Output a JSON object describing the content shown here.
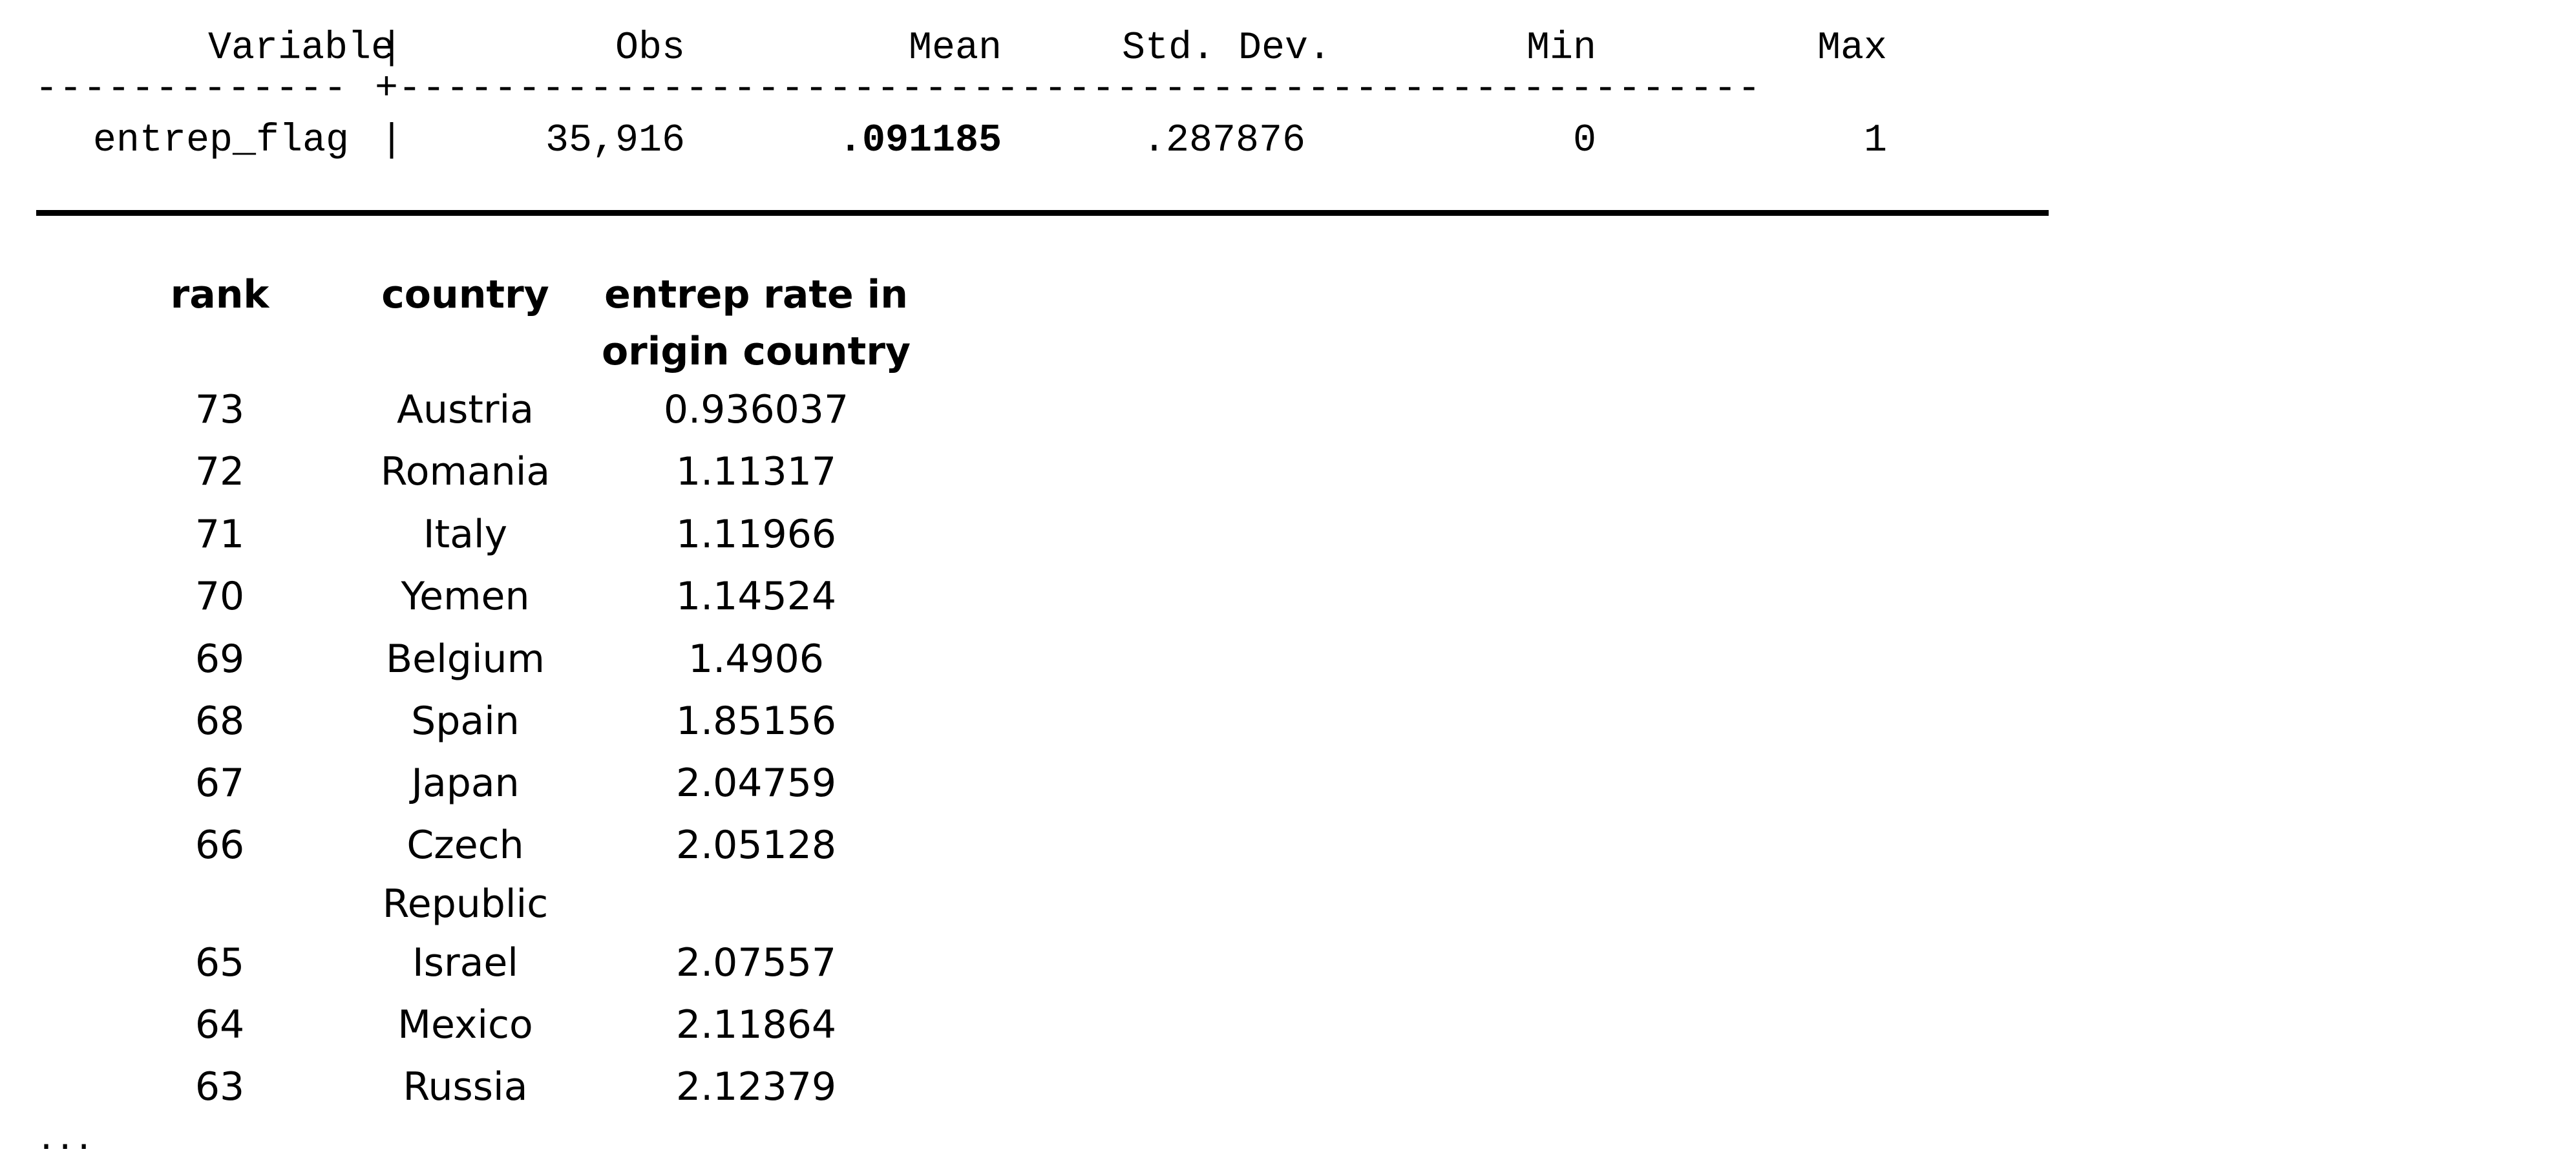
{
  "summary": {
    "headers": {
      "variable": "Variable",
      "sep": "|",
      "obs": "Obs",
      "mean": "Mean",
      "std_dev": "Std. Dev.",
      "min": "Min",
      "max": "Max"
    },
    "rule_left": "-------------",
    "rule_cross": "+",
    "rule_right": "---------------------------------------------------------",
    "row": {
      "variable": "entrep_flag",
      "sep": "|",
      "obs": "35,916",
      "mean": ".091185",
      "std_dev": ".287876",
      "min": "0",
      "max": "1"
    }
  },
  "ranking": {
    "headers": {
      "rank": "rank",
      "country": "country",
      "rate_line1": "entrep rate in",
      "rate_line2": "origin country"
    },
    "rows": [
      {
        "rank": "73",
        "country": "Austria",
        "rate": "0.936037"
      },
      {
        "rank": "72",
        "country": "Romania",
        "rate": "1.11317"
      },
      {
        "rank": "71",
        "country": "Italy",
        "rate": "1.11966"
      },
      {
        "rank": "70",
        "country": "Yemen",
        "rate": "1.14524"
      },
      {
        "rank": "69",
        "country": "Belgium",
        "rate": "1.4906"
      },
      {
        "rank": "68",
        "country": "Spain",
        "rate": "1.85156"
      },
      {
        "rank": "67",
        "country": "Japan",
        "rate": "2.04759"
      },
      {
        "rank": "66",
        "country": "Czech",
        "country_line2": "Republic",
        "rate": "2.05128"
      },
      {
        "rank": "65",
        "country": "Israel",
        "rate": "2.07557"
      },
      {
        "rank": "64",
        "country": "Mexico",
        "rate": "2.11864"
      },
      {
        "rank": "63",
        "country": "Russia",
        "rate": "2.12379"
      }
    ],
    "ellipsis": "..."
  }
}
